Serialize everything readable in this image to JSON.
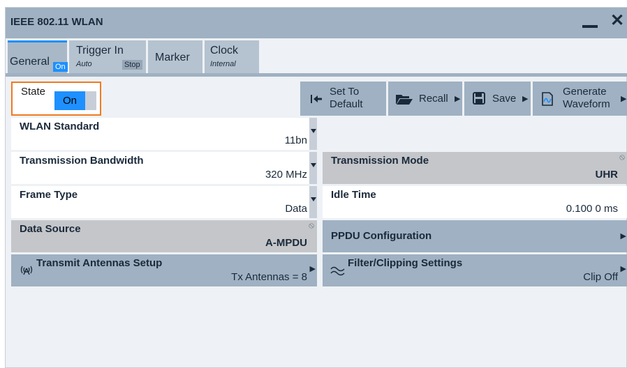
{
  "window": {
    "title": "IEEE 802.11 WLAN"
  },
  "tabs": [
    {
      "label": "General",
      "badge": "On"
    },
    {
      "label": "Trigger In",
      "sub": "Auto",
      "badge": "Stop"
    },
    {
      "label": "Marker"
    },
    {
      "label": "Clock",
      "sub": "Internal"
    }
  ],
  "state": {
    "label": "State",
    "value": "On"
  },
  "toolbar": {
    "set_default": [
      "Set To",
      "Default"
    ],
    "recall": "Recall",
    "save": "Save",
    "generate": [
      "Generate",
      "Waveform"
    ]
  },
  "fields": {
    "wlan_standard": {
      "label": "WLAN Standard",
      "value": "11bn"
    },
    "tx_bandwidth": {
      "label": "Transmission Bandwidth",
      "value": "320 MHz"
    },
    "tx_mode": {
      "label": "Transmission Mode",
      "value": "UHR"
    },
    "frame_type": {
      "label": "Frame Type",
      "value": "Data"
    },
    "idle_time": {
      "label": "Idle Time",
      "value": "0.100 0 ms"
    },
    "data_source": {
      "label": "Data Source",
      "value": "A-MPDU"
    },
    "ppdu_config": {
      "label": "PPDU Configuration"
    },
    "tx_antennas": {
      "label": "Transmit Antennas Setup",
      "value": "Tx Antennas = 8"
    },
    "filter": {
      "label": "Filter/Clipping Settings",
      "value": "Clip Off"
    }
  },
  "colors": {
    "accent": "#1e90ff",
    "highlight": "#f07a22",
    "button": "#9fb1c2",
    "disabled": "#c4c6c9"
  }
}
